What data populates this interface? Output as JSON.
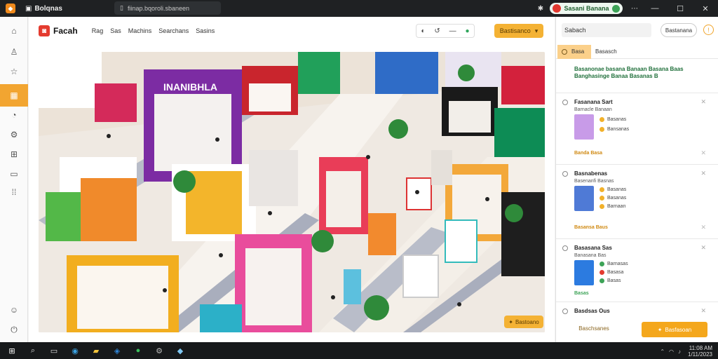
{
  "titlebar": {
    "app_name": "Bolqnas",
    "address": "fiinap.bqoroli.sbaneen",
    "profile_label": "Sasani Banana",
    "icons": [
      "extensions-icon",
      "profile-icon",
      "more-icon"
    ],
    "window_controls": [
      "—",
      "☐",
      "✕"
    ]
  },
  "leftnav": {
    "items": [
      "home-icon",
      "user-icon",
      "star-icon",
      "store-icon",
      "chart-icon",
      "settings-icon",
      "grid-icon",
      "layers-icon",
      "apps-icon",
      "help-icon",
      "power-icon"
    ],
    "active_index": 3
  },
  "main": {
    "brand": "Facah",
    "menu": [
      "Rag",
      "Sas",
      "Machins",
      "Searchans",
      "Sasins"
    ],
    "tools": [
      "◐",
      "↺",
      "—",
      "●"
    ],
    "primary_label": "Bastisanco",
    "scene_button": "Bastoano",
    "scene_store_sign": "INANIBHLA",
    "colors": {
      "accent": "#f4b234",
      "brand": "#e43b2f"
    }
  },
  "right": {
    "search_value": "Sabach",
    "outline_label": "Bastanana",
    "info_icon": "!",
    "tabs": [
      "Basa",
      "Basasch"
    ],
    "summary": "Basanonae basana Banaan Basana Baas Banghasinge Banaa Basanas B",
    "cards": [
      {
        "title": "Fasanana Sart",
        "sub": "Barnacle Banaan",
        "stats": [
          "Basanas",
          "Bansanas"
        ],
        "foot": "Banda Basa",
        "thumb": "#c89be8"
      },
      {
        "title": "Basnabenas",
        "sub": "Basenanfi Basnas",
        "stats": [
          "Basanas",
          "Basanas",
          "Barnaan"
        ],
        "foot": "Basansa Baus",
        "thumb": "#4f7ad6"
      },
      {
        "title": "Basasana Sas",
        "sub": "Banasana Bas",
        "stats": [
          "Barnasas",
          "Basasa",
          "Basas"
        ],
        "foot": "Basas",
        "thumb": "#2c7be0"
      }
    ],
    "last_item": "Basdsas Ous",
    "cancel_label": "Baschsanes",
    "confirm_label": "Basfasoan"
  },
  "taskbar": {
    "icons": [
      "start-icon",
      "search-icon",
      "taskview-icon",
      "edge-icon",
      "folder-icon",
      "store-icon",
      "chat-icon",
      "settings-icon",
      "app-icon"
    ],
    "time": "11:08 AM",
    "date": "1/11/2023"
  }
}
